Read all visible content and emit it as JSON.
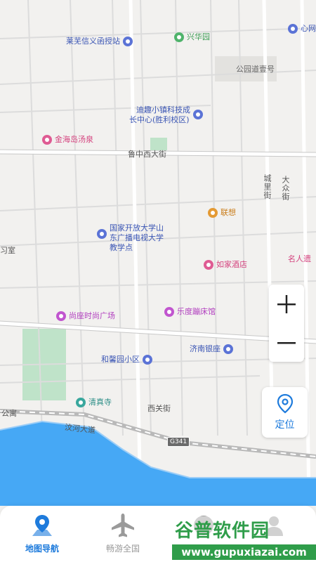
{
  "map": {
    "pois": [
      {
        "id": "laiwu",
        "label": "莱芜信义函授站",
        "color": "blue"
      },
      {
        "id": "xinghua",
        "label": "兴华园",
        "color": "green"
      },
      {
        "id": "xin",
        "label": "心网",
        "color": "blue"
      },
      {
        "id": "park",
        "label": "公园道壹号",
        "color": "gray"
      },
      {
        "id": "diqu",
        "label": "迪趣小镇科技成",
        "color": "blue"
      },
      {
        "id": "diqu2",
        "label": "长中心(胜利校区)",
        "color": "blue"
      },
      {
        "id": "jinhai",
        "label": "金海岛汤泉",
        "color": "pink"
      },
      {
        "id": "lianxiang",
        "label": "联想",
        "color": "orange"
      },
      {
        "id": "open1",
        "label": "国家开放大学山",
        "color": "blue"
      },
      {
        "id": "open2",
        "label": "东广播电视大学",
        "color": "blue"
      },
      {
        "id": "open3",
        "label": "教学点",
        "color": "blue"
      },
      {
        "id": "rujia",
        "label": "如家酒店",
        "color": "pink"
      },
      {
        "id": "mingren",
        "label": "名人遗",
        "color": "pink"
      },
      {
        "id": "shangzuo",
        "label": "尚座时尚广场",
        "color": "purple"
      },
      {
        "id": "ledu",
        "label": "乐度蹦床馆",
        "color": "purple"
      },
      {
        "id": "jinan",
        "label": "济南银座",
        "color": "blue"
      },
      {
        "id": "hexin",
        "label": "和馨园小区",
        "color": "blue"
      },
      {
        "id": "qingzhen",
        "label": "清真寺",
        "color": "teal"
      },
      {
        "id": "apt",
        "label": "公寓",
        "color": "gray"
      },
      {
        "id": "left",
        "label": "习室",
        "color": "gray"
      }
    ],
    "streets": {
      "luzhong": "鲁中西大街",
      "dazhong": "大众街",
      "chengli": "城里街",
      "xiguan": "西关街",
      "wenhe": "汶河大道"
    },
    "shield": "G341"
  },
  "controls": {
    "zoom_in": "+",
    "zoom_out": "−",
    "locate_label": "定位"
  },
  "tabs": [
    {
      "label": "地图导航",
      "icon": "navigation-pin-icon",
      "active": true
    },
    {
      "label": "畅游全国",
      "icon": "airplane-icon",
      "active": false
    },
    {
      "label": "",
      "icon": "compass-icon",
      "active": false
    },
    {
      "label": "",
      "icon": "user-icon",
      "active": false
    }
  ],
  "watermark": {
    "title": "谷普软件园",
    "url": "www.gupuxiazai.com"
  },
  "colors": {
    "accent": "#1e7bdc",
    "water": "#46a8f5",
    "green_area": "#5fb878"
  }
}
